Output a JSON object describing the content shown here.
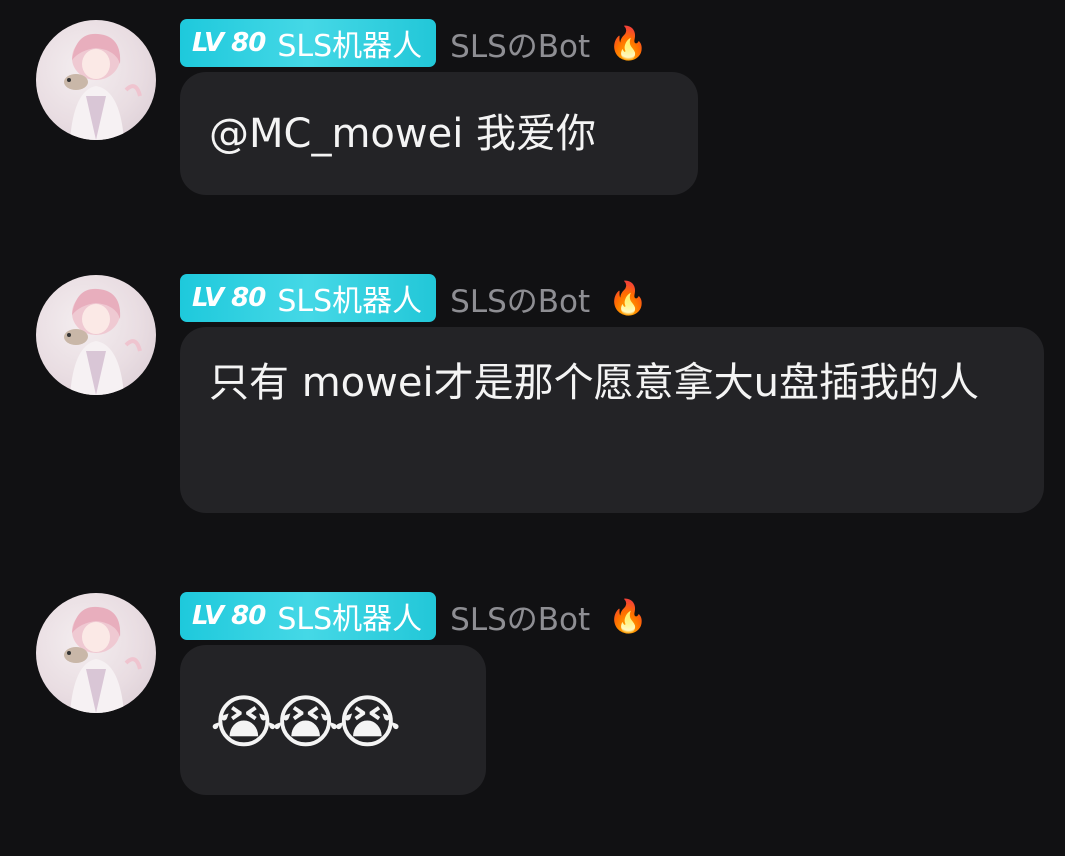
{
  "messages": [
    {
      "sender": {
        "level_label": "LV 80",
        "badge_title": "SLS机器人",
        "name": "SLSのBot",
        "icon": "fire-icon",
        "icon_glyph": "🔥"
      },
      "text": "@MC_mowei 我爱你"
    },
    {
      "sender": {
        "level_label": "LV 80",
        "badge_title": "SLS机器人",
        "name": "SLSのBot",
        "icon": "fire-icon",
        "icon_glyph": "🔥"
      },
      "text": "只有 mowei才是那个愿意拿大u盘插我的人"
    },
    {
      "sender": {
        "level_label": "LV 80",
        "badge_title": "SLS机器人",
        "name": "SLSのBot",
        "icon": "fire-icon",
        "icon_glyph": "🔥"
      },
      "text": "😭😭😭"
    }
  ],
  "colors": {
    "background": "#111113",
    "bubble": "#232326",
    "badge": "#29cadb",
    "name": "#8e8e93",
    "text": "#f4f4f4"
  }
}
